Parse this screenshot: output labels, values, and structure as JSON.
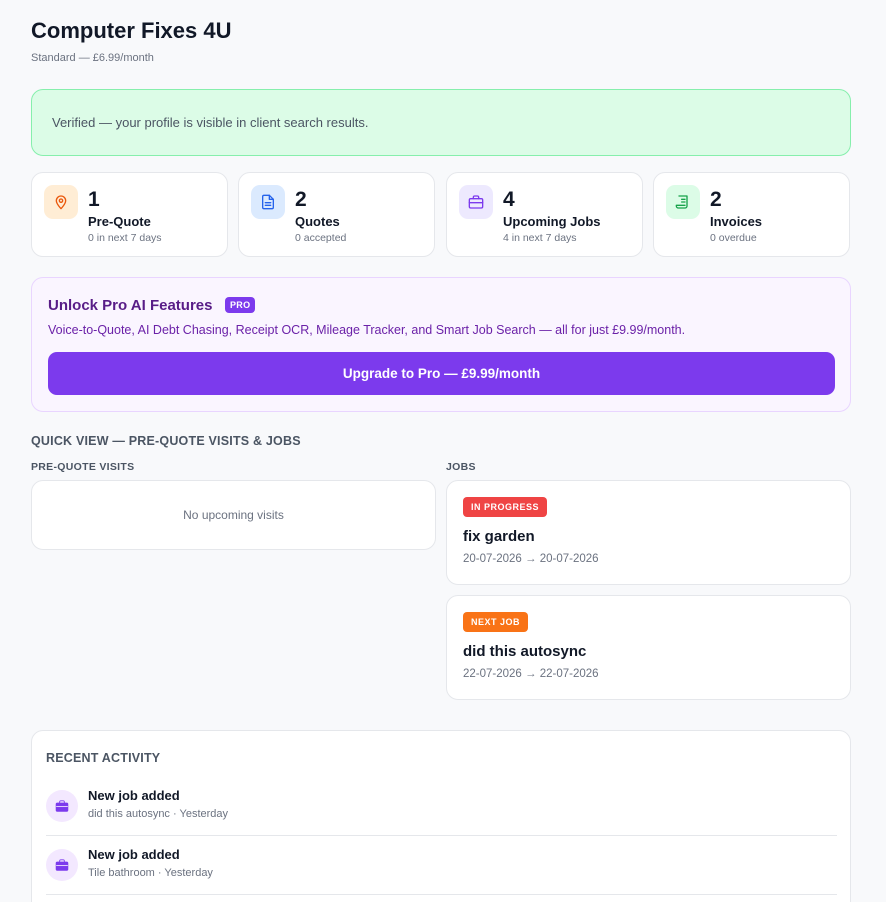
{
  "header": {
    "title": "Computer Fixes 4U",
    "subtitle": "Standard — £6.99/month"
  },
  "verified_banner": "Verified — your profile is visible in client search results.",
  "stats": [
    {
      "icon": "map-pin-icon",
      "number": "1",
      "label": "Pre-Quote",
      "sub": "0 in next 7 days",
      "color": "#ea580c",
      "bg": "#ffedd5"
    },
    {
      "icon": "document-icon",
      "number": "2",
      "label": "Quotes",
      "sub": "0 accepted",
      "color": "#2563eb",
      "bg": "#dbeafe"
    },
    {
      "icon": "briefcase-icon",
      "number": "4",
      "label": "Upcoming Jobs",
      "sub": "4 in next 7 days",
      "color": "#7c3aed",
      "bg": "#ede9fe"
    },
    {
      "icon": "receipt-icon",
      "number": "2",
      "label": "Invoices",
      "sub": "0 overdue",
      "color": "#16a34a",
      "bg": "#dcfce7"
    }
  ],
  "pro_promo": {
    "title": "Unlock Pro AI Features",
    "badge": "PRO",
    "description": "Voice-to-Quote, AI Debt Chasing, Receipt OCR, Mileage Tracker, and Smart Job Search — all for just £9.99/month.",
    "button": "Upgrade to Pro — £9.99/month"
  },
  "quick_view": {
    "heading": "QUICK VIEW — PRE-QUOTE VISITS & JOBS",
    "visits_heading": "PRE-QUOTE VISITS",
    "visits_empty": "No upcoming visits",
    "jobs_heading": "JOBS",
    "jobs": [
      {
        "tag": "IN PROGRESS",
        "tag_color": "#ef4444",
        "name": "fix garden",
        "dates": "20-07-2026 → 20-07-2026"
      },
      {
        "tag": "NEXT JOB",
        "tag_color": "#f97316",
        "name": "did this autosync",
        "dates": "22-07-2026 → 22-07-2026"
      }
    ]
  },
  "activity": {
    "heading": "RECENT ACTIVITY",
    "items": [
      {
        "icon": "briefcase-icon",
        "title": "New job added",
        "sub": "did this autosync · Yesterday"
      },
      {
        "icon": "briefcase-icon",
        "title": "New job added",
        "sub": "Tile bathroom · Yesterday"
      }
    ]
  }
}
